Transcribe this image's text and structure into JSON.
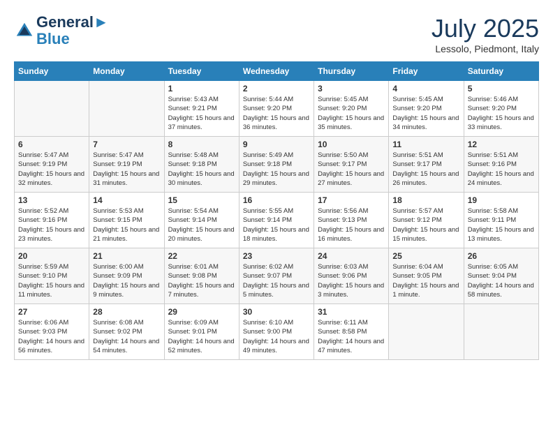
{
  "header": {
    "logo_line1": "General",
    "logo_line2": "Blue",
    "month": "July 2025",
    "location": "Lessolo, Piedmont, Italy"
  },
  "days_of_week": [
    "Sunday",
    "Monday",
    "Tuesday",
    "Wednesday",
    "Thursday",
    "Friday",
    "Saturday"
  ],
  "weeks": [
    [
      {
        "day": "",
        "info": ""
      },
      {
        "day": "",
        "info": ""
      },
      {
        "day": "1",
        "info": "Sunrise: 5:43 AM\nSunset: 9:21 PM\nDaylight: 15 hours and 37 minutes."
      },
      {
        "day": "2",
        "info": "Sunrise: 5:44 AM\nSunset: 9:20 PM\nDaylight: 15 hours and 36 minutes."
      },
      {
        "day": "3",
        "info": "Sunrise: 5:45 AM\nSunset: 9:20 PM\nDaylight: 15 hours and 35 minutes."
      },
      {
        "day": "4",
        "info": "Sunrise: 5:45 AM\nSunset: 9:20 PM\nDaylight: 15 hours and 34 minutes."
      },
      {
        "day": "5",
        "info": "Sunrise: 5:46 AM\nSunset: 9:20 PM\nDaylight: 15 hours and 33 minutes."
      }
    ],
    [
      {
        "day": "6",
        "info": "Sunrise: 5:47 AM\nSunset: 9:19 PM\nDaylight: 15 hours and 32 minutes."
      },
      {
        "day": "7",
        "info": "Sunrise: 5:47 AM\nSunset: 9:19 PM\nDaylight: 15 hours and 31 minutes."
      },
      {
        "day": "8",
        "info": "Sunrise: 5:48 AM\nSunset: 9:18 PM\nDaylight: 15 hours and 30 minutes."
      },
      {
        "day": "9",
        "info": "Sunrise: 5:49 AM\nSunset: 9:18 PM\nDaylight: 15 hours and 29 minutes."
      },
      {
        "day": "10",
        "info": "Sunrise: 5:50 AM\nSunset: 9:17 PM\nDaylight: 15 hours and 27 minutes."
      },
      {
        "day": "11",
        "info": "Sunrise: 5:51 AM\nSunset: 9:17 PM\nDaylight: 15 hours and 26 minutes."
      },
      {
        "day": "12",
        "info": "Sunrise: 5:51 AM\nSunset: 9:16 PM\nDaylight: 15 hours and 24 minutes."
      }
    ],
    [
      {
        "day": "13",
        "info": "Sunrise: 5:52 AM\nSunset: 9:16 PM\nDaylight: 15 hours and 23 minutes."
      },
      {
        "day": "14",
        "info": "Sunrise: 5:53 AM\nSunset: 9:15 PM\nDaylight: 15 hours and 21 minutes."
      },
      {
        "day": "15",
        "info": "Sunrise: 5:54 AM\nSunset: 9:14 PM\nDaylight: 15 hours and 20 minutes."
      },
      {
        "day": "16",
        "info": "Sunrise: 5:55 AM\nSunset: 9:14 PM\nDaylight: 15 hours and 18 minutes."
      },
      {
        "day": "17",
        "info": "Sunrise: 5:56 AM\nSunset: 9:13 PM\nDaylight: 15 hours and 16 minutes."
      },
      {
        "day": "18",
        "info": "Sunrise: 5:57 AM\nSunset: 9:12 PM\nDaylight: 15 hours and 15 minutes."
      },
      {
        "day": "19",
        "info": "Sunrise: 5:58 AM\nSunset: 9:11 PM\nDaylight: 15 hours and 13 minutes."
      }
    ],
    [
      {
        "day": "20",
        "info": "Sunrise: 5:59 AM\nSunset: 9:10 PM\nDaylight: 15 hours and 11 minutes."
      },
      {
        "day": "21",
        "info": "Sunrise: 6:00 AM\nSunset: 9:09 PM\nDaylight: 15 hours and 9 minutes."
      },
      {
        "day": "22",
        "info": "Sunrise: 6:01 AM\nSunset: 9:08 PM\nDaylight: 15 hours and 7 minutes."
      },
      {
        "day": "23",
        "info": "Sunrise: 6:02 AM\nSunset: 9:07 PM\nDaylight: 15 hours and 5 minutes."
      },
      {
        "day": "24",
        "info": "Sunrise: 6:03 AM\nSunset: 9:06 PM\nDaylight: 15 hours and 3 minutes."
      },
      {
        "day": "25",
        "info": "Sunrise: 6:04 AM\nSunset: 9:05 PM\nDaylight: 15 hours and 1 minute."
      },
      {
        "day": "26",
        "info": "Sunrise: 6:05 AM\nSunset: 9:04 PM\nDaylight: 14 hours and 58 minutes."
      }
    ],
    [
      {
        "day": "27",
        "info": "Sunrise: 6:06 AM\nSunset: 9:03 PM\nDaylight: 14 hours and 56 minutes."
      },
      {
        "day": "28",
        "info": "Sunrise: 6:08 AM\nSunset: 9:02 PM\nDaylight: 14 hours and 54 minutes."
      },
      {
        "day": "29",
        "info": "Sunrise: 6:09 AM\nSunset: 9:01 PM\nDaylight: 14 hours and 52 minutes."
      },
      {
        "day": "30",
        "info": "Sunrise: 6:10 AM\nSunset: 9:00 PM\nDaylight: 14 hours and 49 minutes."
      },
      {
        "day": "31",
        "info": "Sunrise: 6:11 AM\nSunset: 8:58 PM\nDaylight: 14 hours and 47 minutes."
      },
      {
        "day": "",
        "info": ""
      },
      {
        "day": "",
        "info": ""
      }
    ]
  ]
}
